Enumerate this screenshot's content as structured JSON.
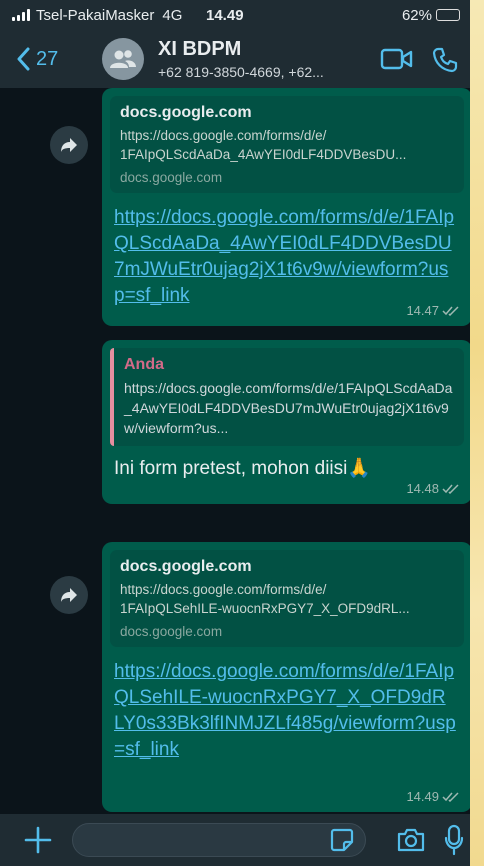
{
  "status_bar": {
    "carrier": "Tsel-PakaiMasker",
    "network": "4G",
    "time": "14.49",
    "battery": "62%"
  },
  "header": {
    "back_count": "27",
    "group_name": "XI BDPM",
    "participants": "+62 819-3850-4669, +62..."
  },
  "messages": [
    {
      "preview_title": "docs.google.com",
      "preview_url_line1": "https://docs.google.com/forms/d/e/",
      "preview_url_line2": "1FAIpQLScdAaDa_4AwYEI0dLF4DDVBesDU...",
      "preview_domain": "docs.google.com",
      "link_text": "https://docs.google.com/forms/d/e/1FAIpQLScdAaDa_4AwYEI0dLF4DDVBesDU7mJWuEtr0ujag2jX1t6v9w/viewform?usp=sf_link",
      "time": "14.47"
    },
    {
      "quote_author": "Anda",
      "quote_text": "https://docs.google.com/forms/d/e/1FAIpQLScdAaDa_4AwYEI0dLF4DDVBesDU7mJWuEtr0ujag2jX1t6v9w/viewform?us...",
      "text": "Ini form pretest, mohon diisi🙏",
      "time": "14.48"
    },
    {
      "preview_title": "docs.google.com",
      "preview_url_line1": "https://docs.google.com/forms/d/e/",
      "preview_url_line2": "1FAIpQLSehILE-wuocnRxPGY7_X_OFD9dRL...",
      "preview_domain": "docs.google.com",
      "link_text": "https://docs.google.com/forms/d/e/1FAIpQLSehILE-wuocnRxPGY7_X_OFD9dRLY0s33Bk3lfINMJZLf485g/viewform?usp=sf_link",
      "time": "14.49"
    }
  ],
  "icons": {
    "forward": "forward-icon",
    "video": "video-call-icon",
    "phone": "voice-call-icon",
    "plus": "plus-icon",
    "sticker": "sticker-icon",
    "camera": "camera-icon",
    "mic": "microphone-icon"
  },
  "colors": {
    "accent": "#53bdeb",
    "outgoing_bubble": "#005c4b",
    "header_bg": "#1f2c33",
    "quote_author": "#d36a88"
  }
}
